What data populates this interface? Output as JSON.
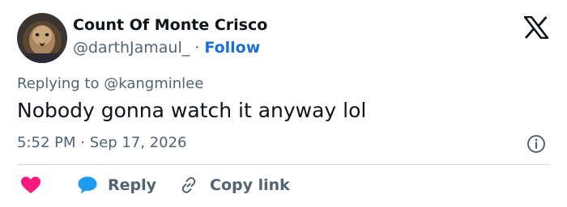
{
  "author": {
    "display_name": "Count Of Monte Crisco",
    "handle": "@darthJamaul_",
    "separator": "·",
    "follow_label": "Follow"
  },
  "reply_context": {
    "prefix": "Replying to",
    "mention": "@kangminlee"
  },
  "tweet": {
    "text": "Nobody gonna watch it anyway lol",
    "timestamp": "5:52 PM · Sep 17, 2026"
  },
  "actions": {
    "reply_label": "Reply",
    "copy_link_label": "Copy link"
  },
  "icons": {
    "brand": "x-logo-icon",
    "info": "info-icon",
    "like": "heart-icon",
    "reply": "speech-bubble-icon",
    "copy": "link-icon"
  },
  "colors": {
    "text_primary": "#0f1419",
    "text_secondary": "#536471",
    "link_blue": "#1d6fdc",
    "heart_pink": "#f91880",
    "bubble_blue": "#1d9bf0",
    "divider": "#cfd9de"
  }
}
